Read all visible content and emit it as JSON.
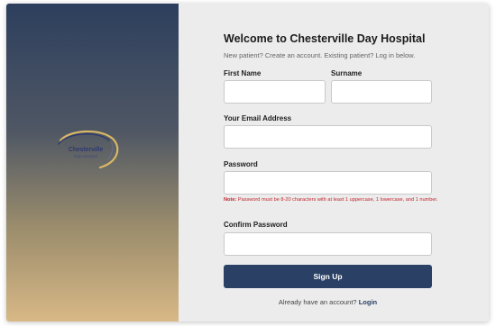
{
  "brand": {
    "logo_name": "Chesterville",
    "logo_sub": "Day Hospital"
  },
  "form": {
    "title": "Welcome to Chesterville Day Hospital",
    "subtitle": "New patient? Create an account. Existing patient? Log in below.",
    "first_name_label": "First Name",
    "first_name_value": "",
    "surname_label": "Surname",
    "surname_value": "",
    "email_label": "Your Email Address",
    "email_value": "",
    "password_label": "Password",
    "password_value": "",
    "note_prefix": "Note:",
    "note_text": " Password must be 8-20 characters with at least 1 uppercase, 1 lowercase, and 1 number.",
    "confirm_label": "Confirm Password",
    "confirm_value": "",
    "signup_label": "Sign Up",
    "login_prompt": "Already have an account?",
    "login_link": "Login"
  },
  "colors": {
    "primary": "#2a4165",
    "note": "#c1272d",
    "panel_background": "#ececec"
  }
}
